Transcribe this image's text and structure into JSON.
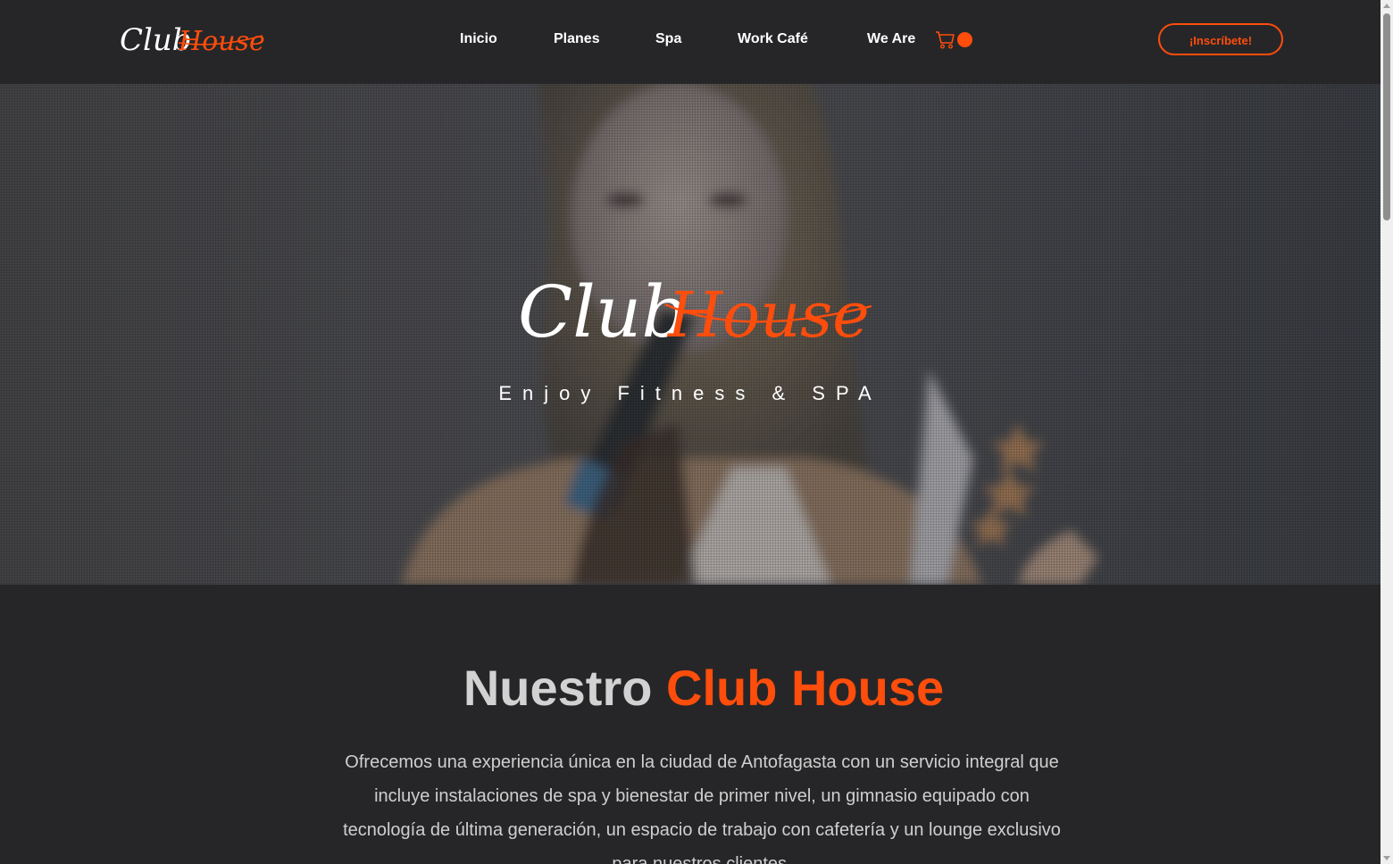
{
  "brand": {
    "word1": "Club",
    "word2": "House",
    "accent_color": "#ff4d0c",
    "text_color": "#ffffff"
  },
  "header": {
    "nav": [
      {
        "label": "Inicio"
      },
      {
        "label": "Planes"
      },
      {
        "label": "Spa"
      },
      {
        "label": "Work Café"
      },
      {
        "label": "We Are"
      }
    ],
    "cart_icon": "shopping-cart-icon",
    "cta_label": "¡Inscríbete!"
  },
  "hero": {
    "tagline": "Enjoy Fitness & SPA"
  },
  "about": {
    "title_part1": "Nuestro ",
    "title_part2": "Club House",
    "text": "Ofrecemos una experiencia única en la ciudad de Antofagasta con un servicio integral que incluye instalaciones de spa y bienestar de primer nivel, un gimnasio equipado con tecnología de última generación, un espacio de trabajo con cafetería y un lounge exclusivo para nuestros clientes."
  },
  "colors": {
    "background": "#262628",
    "accent": "#ff4d0c",
    "heading_gray": "#d2d2d2"
  }
}
